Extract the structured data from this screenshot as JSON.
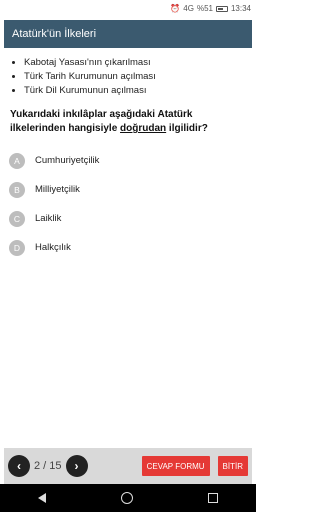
{
  "status_bar": {
    "signal_label": "4G",
    "battery_text": "%51",
    "time": "13:34"
  },
  "header": {
    "title": "Atatürk'ün İlkeleri"
  },
  "bullets": [
    "Kabotaj Yasası'nın çıkarılması",
    "Türk Tarih Kurumunun açılması",
    "Türk Dil Kurumunun açılması"
  ],
  "question": {
    "part1": "Yukarıdaki inkılâplar aşağıdaki Atatürk ilkelerinden hangisiyle ",
    "underlined": "doğrudan",
    "part2": " ilgilidir?"
  },
  "options": [
    {
      "letter": "A",
      "text": "Cumhuriyetçilik"
    },
    {
      "letter": "B",
      "text": "Milliyetçilik"
    },
    {
      "letter": "C",
      "text": "Laiklik"
    },
    {
      "letter": "D",
      "text": "Halkçılık"
    }
  ],
  "bottom_bar": {
    "prev_icon": "chevron-left-icon",
    "next_icon": "chevron-right-icon",
    "page_indicator": "2 / 15",
    "answer_button": "CEVAP FORMU",
    "finish_button": "BİTİR"
  },
  "colors": {
    "header_bg": "#3b5a6f",
    "red_button": "#e53935",
    "option_circle": "#bdbdbd",
    "bottom_bar_bg": "#d9d9d9"
  }
}
